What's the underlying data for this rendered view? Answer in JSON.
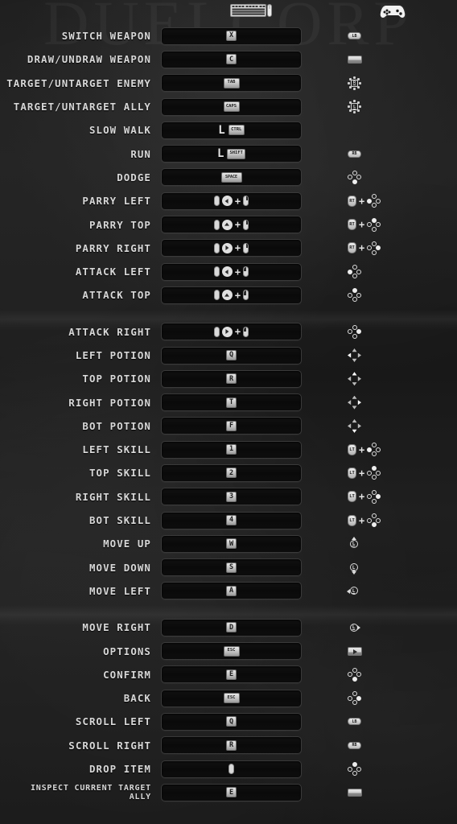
{
  "background": {
    "watermark_text": "DUELCORP",
    "page_bg": "#1d1d1d",
    "accent": "#e0e0e0"
  },
  "header": {
    "keyboard_mouse_icon": "keyboard-mouse-icon",
    "gamepad_icon": "gamepad-icon"
  },
  "sections": [
    {
      "id": "combat",
      "rows": [
        {
          "action": "SWITCH WEAPON",
          "key": "X",
          "key_type": "cap",
          "gamepad": "LB"
        },
        {
          "action": "DRAW/UNDRAW WEAPON",
          "key": "C",
          "key_type": "cap",
          "gamepad": "SELECT"
        },
        {
          "action": "TARGET/UNTARGET ENEMY",
          "key": "TAB",
          "key_type": "cap-wide",
          "gamepad": "R3"
        },
        {
          "action": "TARGET/UNTARGET ALLY",
          "key": "CAPS",
          "key_type": "cap-wide",
          "gamepad": "L3"
        },
        {
          "action": "SLOW WALK",
          "key": "CTRL",
          "key_type": "l-mod",
          "gamepad": ""
        },
        {
          "action": "RUN",
          "key": "SHIFT",
          "key_type": "l-mod",
          "gamepad": "RB"
        },
        {
          "action": "DODGE",
          "key": "SPACE",
          "key_type": "cap-xwide",
          "gamepad": "A"
        },
        {
          "action": "PARRY LEFT",
          "key": "MOUSE-LEFTDIR-RMB",
          "key_type": "mouse-combo",
          "gamepad": "RT+DPAD-LEFT"
        },
        {
          "action": "PARRY TOP",
          "key": "MOUSE-UPDIR-RMB",
          "key_type": "mouse-combo",
          "gamepad": "RT+DPAD-UP"
        },
        {
          "action": "PARRY RIGHT",
          "key": "MOUSE-RIGHTDIR-RMB",
          "key_type": "mouse-combo",
          "gamepad": "RT+DPAD-RIGHT"
        },
        {
          "action": "ATTACK LEFT",
          "key": "MOUSE-LEFTDIR-LMB",
          "key_type": "mouse-combo",
          "gamepad": "DPAD-LEFT"
        },
        {
          "action": "ATTACK TOP",
          "key": "MOUSE-UPDIR-LMB",
          "key_type": "mouse-combo",
          "gamepad": "DPAD-UP"
        }
      ]
    },
    {
      "id": "items-skills",
      "rows": [
        {
          "action": "ATTACK RIGHT",
          "key": "MOUSE-RIGHTDIR-LMB",
          "key_type": "mouse-combo",
          "gamepad": "DPAD-RIGHT"
        },
        {
          "action": "LEFT POTION",
          "key": "Q",
          "key_type": "cap",
          "gamepad": "DPAD-SOLID-LEFT"
        },
        {
          "action": "TOP POTION",
          "key": "R",
          "key_type": "cap",
          "gamepad": "DPAD-SOLID-UP"
        },
        {
          "action": "RIGHT POTION",
          "key": "T",
          "key_type": "cap",
          "gamepad": "DPAD-SOLID-RIGHT"
        },
        {
          "action": "BOT POTION",
          "key": "F",
          "key_type": "cap",
          "gamepad": "DPAD-SOLID-DOWN"
        },
        {
          "action": "LEFT SKILL",
          "key": "1",
          "key_type": "cap",
          "gamepad": "LT+DPAD-LEFT"
        },
        {
          "action": "TOP SKILL",
          "key": "2",
          "key_type": "cap",
          "gamepad": "LT+DPAD-UP"
        },
        {
          "action": "RIGHT SKILL",
          "key": "3",
          "key_type": "cap",
          "gamepad": "LT+DPAD-RIGHT"
        },
        {
          "action": "BOT SKILL",
          "key": "4",
          "key_type": "cap",
          "gamepad": "LT+DPAD-DOWN"
        },
        {
          "action": "MOVE UP",
          "key": "W",
          "key_type": "cap",
          "gamepad": "LSTICK-UP"
        },
        {
          "action": "MOVE DOWN",
          "key": "S",
          "key_type": "cap",
          "gamepad": "LSTICK-DOWN"
        },
        {
          "action": "MOVE LEFT",
          "key": "A",
          "key_type": "cap",
          "gamepad": "LSTICK-LEFT"
        }
      ]
    },
    {
      "id": "interface",
      "rows": [
        {
          "action": "MOVE RIGHT",
          "key": "D",
          "key_type": "cap",
          "gamepad": "LSTICK-RIGHT"
        },
        {
          "action": "OPTIONS",
          "key": "ESC",
          "key_type": "cap-wide",
          "gamepad": "START"
        },
        {
          "action": "CONFIRM",
          "key": "E",
          "key_type": "cap",
          "gamepad": "A"
        },
        {
          "action": "BACK",
          "key": "ESC",
          "key_type": "cap-wide",
          "gamepad": "B"
        },
        {
          "action": "SCROLL LEFT",
          "key": "Q",
          "key_type": "cap",
          "gamepad": "LB"
        },
        {
          "action": "SCROLL RIGHT",
          "key": "R",
          "key_type": "cap",
          "gamepad": "RB"
        },
        {
          "action": "DROP ITEM",
          "key": "MOUSE-MIDDLE",
          "key_type": "mouse",
          "gamepad": "Y"
        },
        {
          "action": "INSPECT CURRENT TARGET ALLY",
          "key": "E",
          "key_type": "cap",
          "gamepad": "SELECT",
          "two_line": true
        }
      ]
    }
  ]
}
